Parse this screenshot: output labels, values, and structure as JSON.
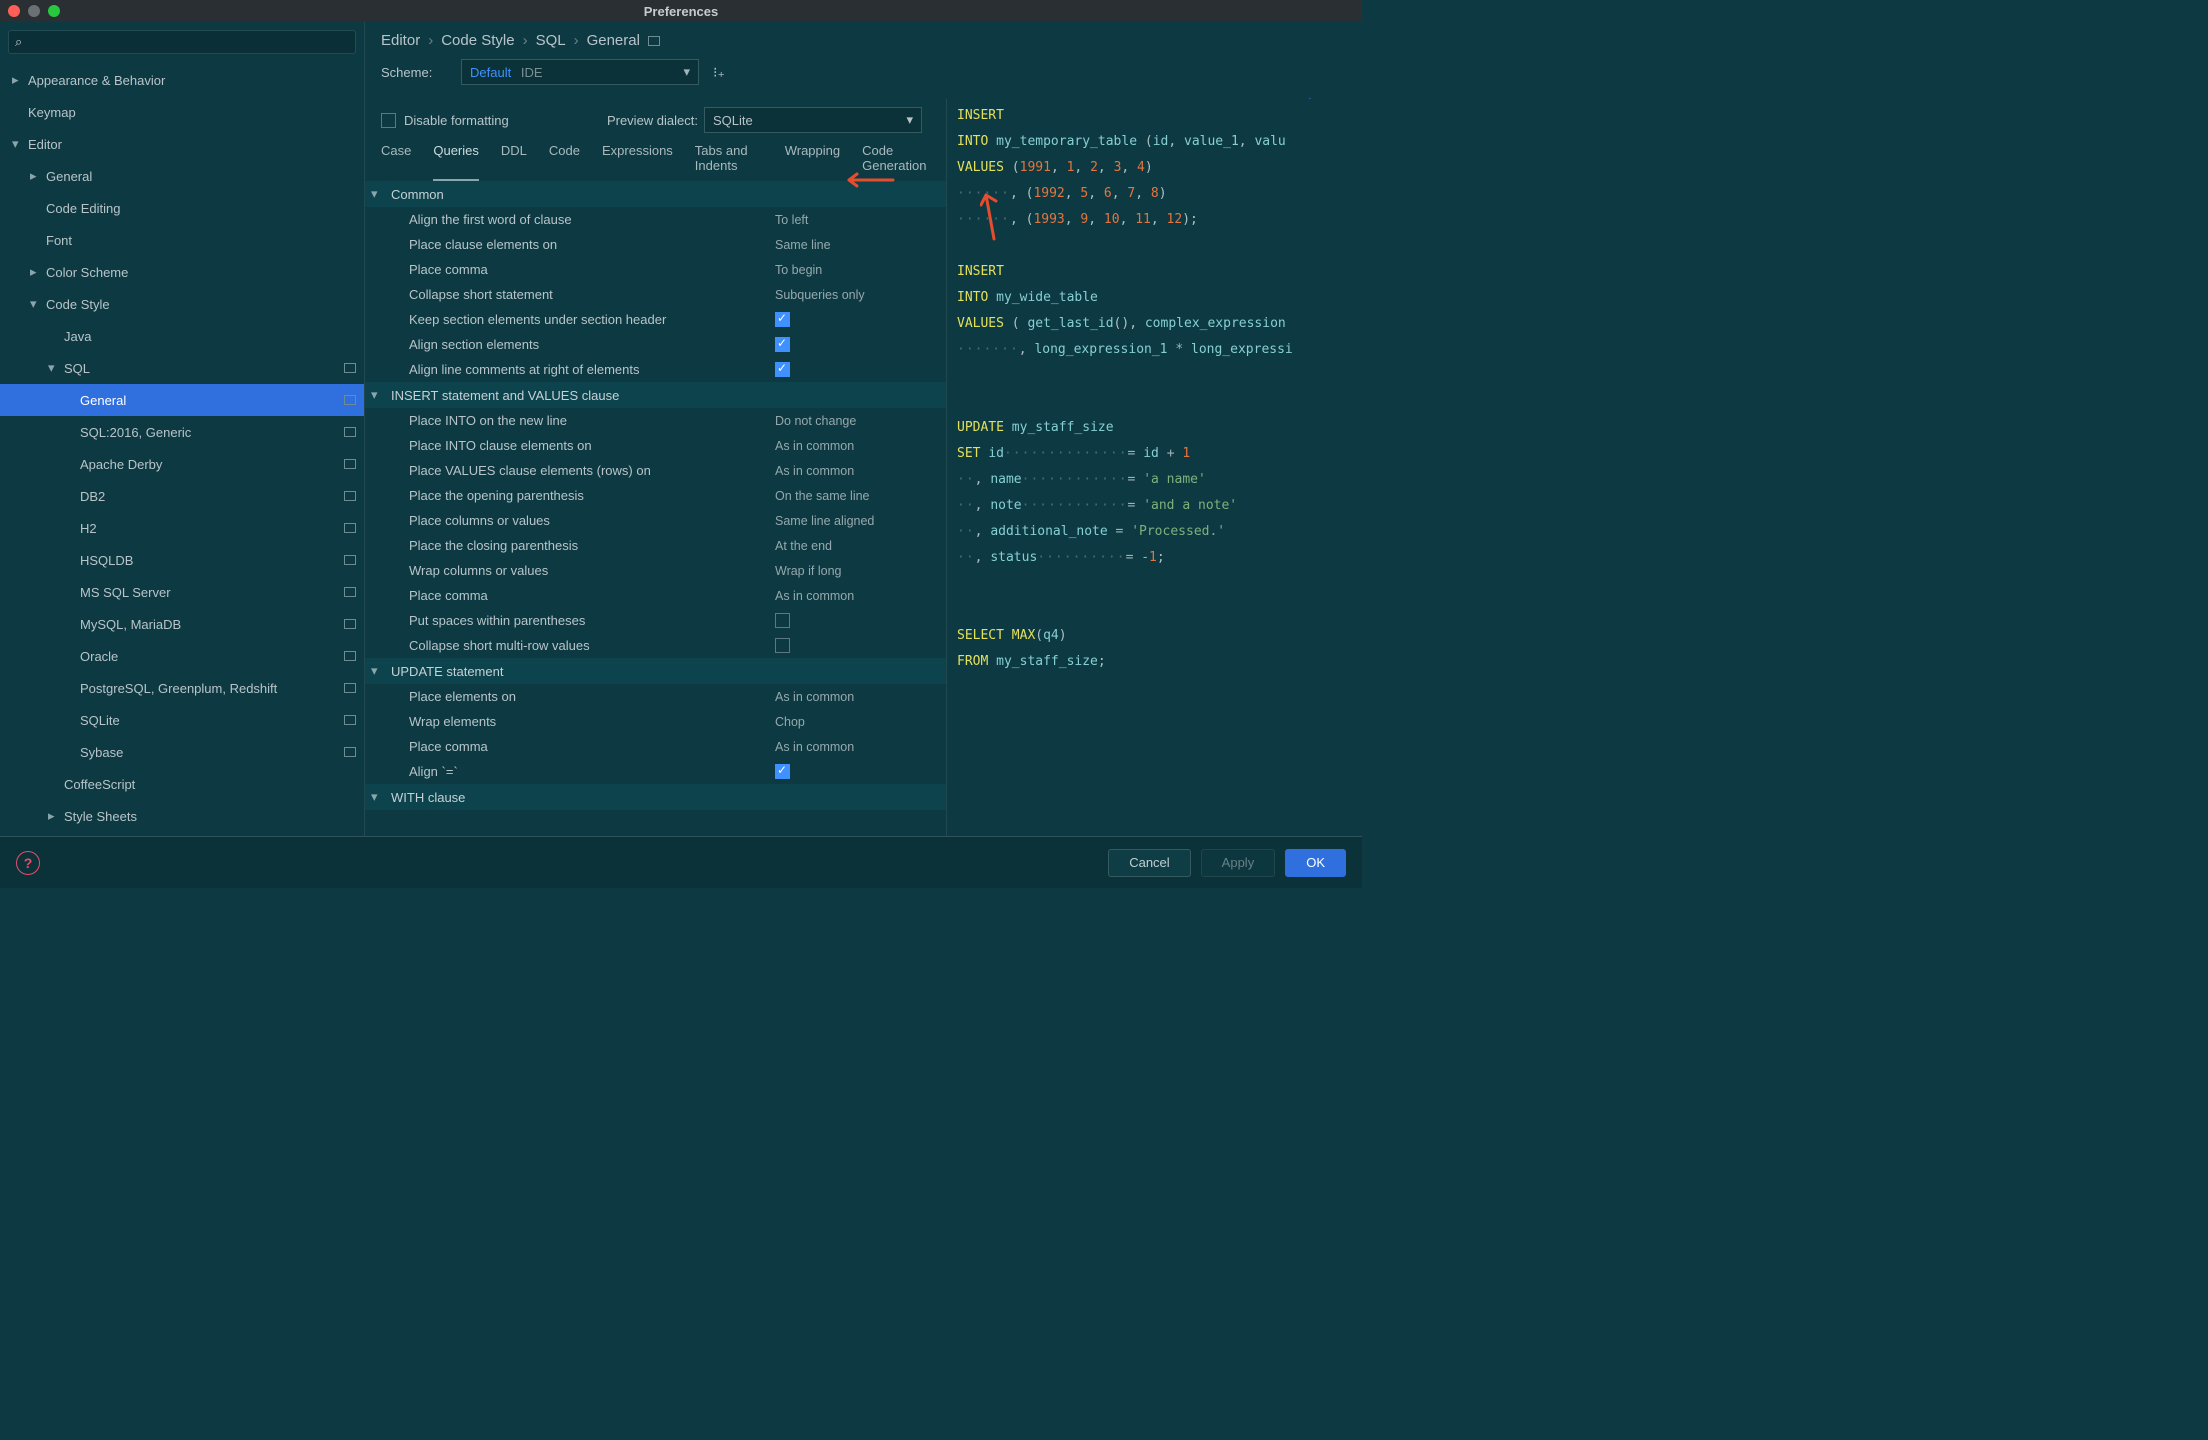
{
  "window": {
    "title": "Preferences"
  },
  "search": {
    "placeholder": ""
  },
  "sidebar": {
    "items": [
      {
        "label": "Appearance & Behavior",
        "indent": 0,
        "chev": "right"
      },
      {
        "label": "Keymap",
        "indent": 0,
        "chev": "none"
      },
      {
        "label": "Editor",
        "indent": 0,
        "chev": "down"
      },
      {
        "label": "General",
        "indent": 1,
        "chev": "right"
      },
      {
        "label": "Code Editing",
        "indent": 1,
        "chev": "none"
      },
      {
        "label": "Font",
        "indent": 1,
        "chev": "none"
      },
      {
        "label": "Color Scheme",
        "indent": 1,
        "chev": "right"
      },
      {
        "label": "Code Style",
        "indent": 1,
        "chev": "down"
      },
      {
        "label": "Java",
        "indent": 2,
        "chev": "none"
      },
      {
        "label": "SQL",
        "indent": 2,
        "chev": "down",
        "badge": true
      },
      {
        "label": "General",
        "indent": 3,
        "chev": "none",
        "selected": true,
        "badge": true
      },
      {
        "label": "SQL:2016, Generic",
        "indent": 3,
        "chev": "none",
        "badge": true
      },
      {
        "label": "Apache Derby",
        "indent": 3,
        "chev": "none",
        "badge": true
      },
      {
        "label": "DB2",
        "indent": 3,
        "chev": "none",
        "badge": true
      },
      {
        "label": "H2",
        "indent": 3,
        "chev": "none",
        "badge": true
      },
      {
        "label": "HSQLDB",
        "indent": 3,
        "chev": "none",
        "badge": true
      },
      {
        "label": "MS SQL Server",
        "indent": 3,
        "chev": "none",
        "badge": true
      },
      {
        "label": "MySQL, MariaDB",
        "indent": 3,
        "chev": "none",
        "badge": true
      },
      {
        "label": "Oracle",
        "indent": 3,
        "chev": "none",
        "badge": true
      },
      {
        "label": "PostgreSQL, Greenplum, Redshift",
        "indent": 3,
        "chev": "none",
        "badge": true
      },
      {
        "label": "SQLite",
        "indent": 3,
        "chev": "none",
        "badge": true
      },
      {
        "label": "Sybase",
        "indent": 3,
        "chev": "none",
        "badge": true
      },
      {
        "label": "CoffeeScript",
        "indent": 2,
        "chev": "none"
      },
      {
        "label": "Style Sheets",
        "indent": 2,
        "chev": "right"
      }
    ]
  },
  "breadcrumbs": [
    "Editor",
    "Code Style",
    "SQL",
    "General"
  ],
  "scheme": {
    "label": "Scheme:",
    "name": "Default",
    "tag": "IDE"
  },
  "setFrom": "Set from...",
  "disableFormatting": {
    "label": "Disable formatting",
    "checked": false
  },
  "previewDialect": {
    "label": "Preview dialect:",
    "value": "SQLite"
  },
  "tabs": [
    "Case",
    "Queries",
    "DDL",
    "Code",
    "Expressions",
    "Tabs and Indents",
    "Wrapping",
    "Code Generation"
  ],
  "activeTab": 1,
  "groups": [
    {
      "title": "Common",
      "rows": [
        {
          "label": "Align the first word of clause",
          "value": "To left"
        },
        {
          "label": "Place clause elements on",
          "value": "Same line"
        },
        {
          "label": "Place comma",
          "value": "To begin"
        },
        {
          "label": "Collapse short statement",
          "value": "Subqueries only"
        },
        {
          "label": "Keep section elements under section header",
          "checkbox": true,
          "checked": true
        },
        {
          "label": "Align section elements",
          "checkbox": true,
          "checked": true
        },
        {
          "label": "Align line comments at right of elements",
          "checkbox": true,
          "checked": true
        }
      ]
    },
    {
      "title": "INSERT statement and VALUES clause",
      "rows": [
        {
          "label": "Place INTO on the new line",
          "value": "Do not change"
        },
        {
          "label": "Place INTO clause elements on",
          "value": "As in common"
        },
        {
          "label": "Place VALUES clause elements (rows) on",
          "value": "As in common"
        },
        {
          "label": "Place the opening parenthesis",
          "value": "On the same line"
        },
        {
          "label": "Place columns or values",
          "value": "Same line aligned"
        },
        {
          "label": "Place the closing parenthesis",
          "value": "At the end"
        },
        {
          "label": "Wrap columns or values",
          "value": "Wrap if long"
        },
        {
          "label": "Place comma",
          "value": "As in common"
        },
        {
          "label": "Put spaces within parentheses",
          "checkbox": true,
          "checked": false
        },
        {
          "label": "Collapse short multi-row values",
          "checkbox": true,
          "checked": false
        }
      ]
    },
    {
      "title": "UPDATE statement",
      "rows": [
        {
          "label": "Place elements on",
          "value": "As in common"
        },
        {
          "label": "Wrap elements",
          "value": "Chop"
        },
        {
          "label": "Place comma",
          "value": "As in common"
        },
        {
          "label": "Align `=`",
          "checkbox": true,
          "checked": true
        }
      ]
    },
    {
      "title": "WITH clause",
      "rows": []
    }
  ],
  "preview": {
    "lines": [
      [
        {
          "c": "kw",
          "t": "INSERT"
        }
      ],
      [
        {
          "c": "kw",
          "t": "INTO"
        },
        {
          "c": "sp",
          "t": " "
        },
        {
          "c": "id",
          "t": "my_temporary_table"
        },
        {
          "c": "sp",
          "t": " "
        },
        {
          "c": "pn",
          "t": "("
        },
        {
          "c": "id",
          "t": "id"
        },
        {
          "c": "pn",
          "t": ", "
        },
        {
          "c": "id",
          "t": "value_1"
        },
        {
          "c": "pn",
          "t": ", "
        },
        {
          "c": "id",
          "t": "valu"
        }
      ],
      [
        {
          "c": "kw",
          "t": "VALUES"
        },
        {
          "c": "sp",
          "t": " "
        },
        {
          "c": "pn",
          "t": "("
        },
        {
          "c": "num",
          "t": "1991"
        },
        {
          "c": "pn",
          "t": ", "
        },
        {
          "c": "num",
          "t": "1"
        },
        {
          "c": "pn",
          "t": ", "
        },
        {
          "c": "num",
          "t": "2"
        },
        {
          "c": "pn",
          "t": ", "
        },
        {
          "c": "num",
          "t": "3"
        },
        {
          "c": "pn",
          "t": ", "
        },
        {
          "c": "num",
          "t": "4"
        },
        {
          "c": "pn",
          "t": ")"
        }
      ],
      [
        {
          "c": "dot",
          "t": "······"
        },
        {
          "c": "pn",
          "t": ", ("
        },
        {
          "c": "num",
          "t": "1992"
        },
        {
          "c": "pn",
          "t": ", "
        },
        {
          "c": "num",
          "t": "5"
        },
        {
          "c": "pn",
          "t": ", "
        },
        {
          "c": "num",
          "t": "6"
        },
        {
          "c": "pn",
          "t": ", "
        },
        {
          "c": "num",
          "t": "7"
        },
        {
          "c": "pn",
          "t": ", "
        },
        {
          "c": "num",
          "t": "8"
        },
        {
          "c": "pn",
          "t": ")"
        }
      ],
      [
        {
          "c": "dot",
          "t": "······"
        },
        {
          "c": "pn",
          "t": ", ("
        },
        {
          "c": "num",
          "t": "1993"
        },
        {
          "c": "pn",
          "t": ", "
        },
        {
          "c": "num",
          "t": "9"
        },
        {
          "c": "pn",
          "t": ", "
        },
        {
          "c": "num",
          "t": "10"
        },
        {
          "c": "pn",
          "t": ", "
        },
        {
          "c": "num",
          "t": "11"
        },
        {
          "c": "pn",
          "t": ", "
        },
        {
          "c": "num",
          "t": "12"
        },
        {
          "c": "pn",
          "t": ");"
        }
      ],
      [],
      [
        {
          "c": "kw",
          "t": "INSERT"
        }
      ],
      [
        {
          "c": "kw",
          "t": "INTO"
        },
        {
          "c": "sp",
          "t": " "
        },
        {
          "c": "id",
          "t": "my_wide_table"
        }
      ],
      [
        {
          "c": "kw",
          "t": "VALUES"
        },
        {
          "c": "sp",
          "t": " "
        },
        {
          "c": "pn",
          "t": "( "
        },
        {
          "c": "id",
          "t": "get_last_id"
        },
        {
          "c": "pn",
          "t": "(), "
        },
        {
          "c": "id",
          "t": "complex_expression"
        }
      ],
      [
        {
          "c": "dot",
          "t": "·······"
        },
        {
          "c": "pn",
          "t": ", "
        },
        {
          "c": "id",
          "t": "long_expression_1"
        },
        {
          "c": "sp",
          "t": " "
        },
        {
          "c": "sym",
          "t": "*"
        },
        {
          "c": "sp",
          "t": " "
        },
        {
          "c": "id",
          "t": "long_expressi"
        }
      ],
      [],
      [],
      [
        {
          "c": "kw",
          "t": "UPDATE"
        },
        {
          "c": "sp",
          "t": " "
        },
        {
          "c": "id",
          "t": "my_staff_size"
        }
      ],
      [
        {
          "c": "kw",
          "t": "SET"
        },
        {
          "c": "sp",
          "t": " "
        },
        {
          "c": "id",
          "t": "id"
        },
        {
          "c": "dot",
          "t": "··············"
        },
        {
          "c": "sym",
          "t": "= "
        },
        {
          "c": "id",
          "t": "id"
        },
        {
          "c": "sp",
          "t": " "
        },
        {
          "c": "sym",
          "t": "+"
        },
        {
          "c": "sp",
          "t": " "
        },
        {
          "c": "num",
          "t": "1"
        }
      ],
      [
        {
          "c": "dot",
          "t": "··"
        },
        {
          "c": "pn",
          "t": ", "
        },
        {
          "c": "id",
          "t": "name"
        },
        {
          "c": "dot",
          "t": "············"
        },
        {
          "c": "sym",
          "t": "= "
        },
        {
          "c": "str",
          "t": "'a name'"
        }
      ],
      [
        {
          "c": "dot",
          "t": "··"
        },
        {
          "c": "pn",
          "t": ", "
        },
        {
          "c": "id",
          "t": "note"
        },
        {
          "c": "dot",
          "t": "············"
        },
        {
          "c": "sym",
          "t": "= "
        },
        {
          "c": "str",
          "t": "'and a note'"
        }
      ],
      [
        {
          "c": "dot",
          "t": "··"
        },
        {
          "c": "pn",
          "t": ", "
        },
        {
          "c": "id",
          "t": "additional_note"
        },
        {
          "c": "sp",
          "t": " "
        },
        {
          "c": "sym",
          "t": "= "
        },
        {
          "c": "str",
          "t": "'Processed.'"
        }
      ],
      [
        {
          "c": "dot",
          "t": "··"
        },
        {
          "c": "pn",
          "t": ", "
        },
        {
          "c": "id",
          "t": "status"
        },
        {
          "c": "dot",
          "t": "··········"
        },
        {
          "c": "sym",
          "t": "= "
        },
        {
          "c": "sym",
          "t": "-"
        },
        {
          "c": "num",
          "t": "1"
        },
        {
          "c": "pn",
          "t": ";"
        }
      ],
      [],
      [],
      [
        {
          "c": "kw",
          "t": "SELECT"
        },
        {
          "c": "sp",
          "t": " "
        },
        {
          "c": "kw",
          "t": "MAX"
        },
        {
          "c": "pn",
          "t": "("
        },
        {
          "c": "id",
          "t": "q4"
        },
        {
          "c": "pn",
          "t": ")"
        }
      ],
      [
        {
          "c": "kw",
          "t": "FROM"
        },
        {
          "c": "sp",
          "t": " "
        },
        {
          "c": "id",
          "t": "my_staff_size"
        },
        {
          "c": "pn",
          "t": ";"
        }
      ]
    ]
  },
  "footer": {
    "cancel": "Cancel",
    "apply": "Apply",
    "ok": "OK"
  },
  "search_glyph": "⌕"
}
